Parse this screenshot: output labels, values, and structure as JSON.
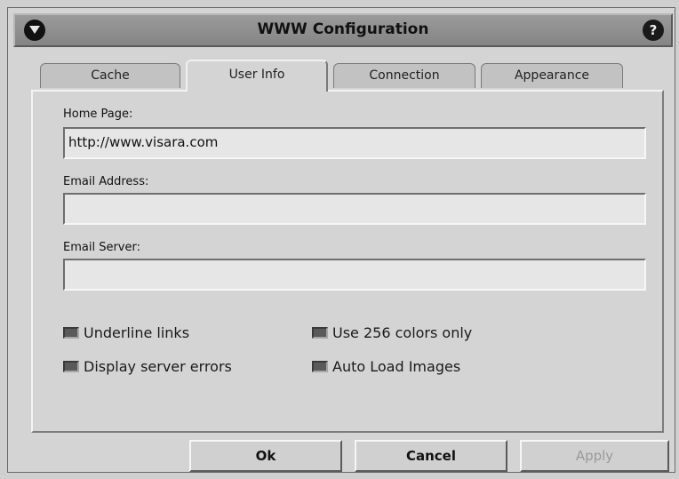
{
  "window": {
    "title": "WWW Configuration",
    "help_label": "?"
  },
  "tabs": [
    {
      "label": "Cache"
    },
    {
      "label": "User Info"
    },
    {
      "label": "Connection"
    },
    {
      "label": "Appearance"
    }
  ],
  "active_tab": "User Info",
  "fields": {
    "home_page": {
      "label": "Home Page:",
      "value": "http://www.visara.com"
    },
    "email_address": {
      "label": "Email Address:",
      "value": ""
    },
    "email_server": {
      "label": "Email Server:",
      "value": ""
    }
  },
  "options": {
    "underline_links": {
      "label": "Underline links",
      "checked": true
    },
    "display_server_errors": {
      "label": "Display server errors",
      "checked": true
    },
    "use_256_colors": {
      "label": "Use 256 colors only",
      "checked": true
    },
    "auto_load_images": {
      "label": "Auto Load Images",
      "checked": true
    }
  },
  "buttons": {
    "ok": "Ok",
    "cancel": "Cancel",
    "apply": "Apply"
  },
  "colors": {
    "background": "#d4d4d4",
    "titlebar": "#8f8f8f",
    "field": "#e6e6e6"
  }
}
